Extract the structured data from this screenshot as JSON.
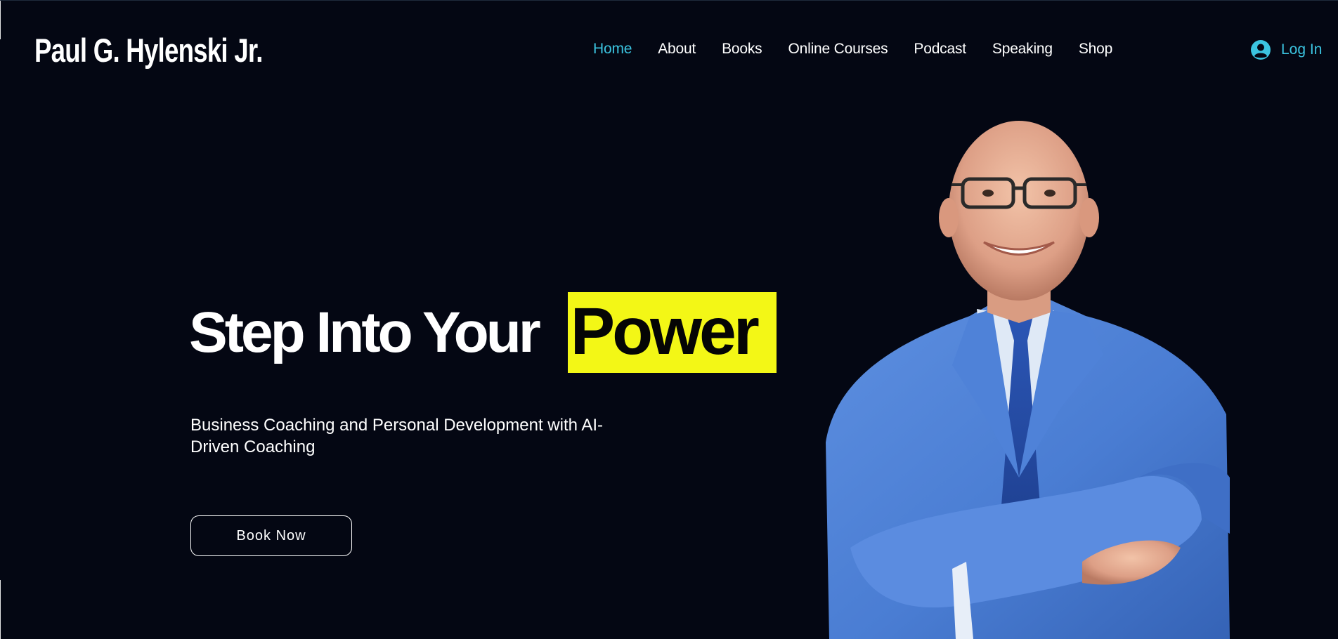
{
  "header": {
    "logo": "Paul G. Hylenski Jr.",
    "nav": [
      {
        "label": "Home",
        "active": true
      },
      {
        "label": "About",
        "active": false
      },
      {
        "label": "Books",
        "active": false
      },
      {
        "label": "Online Courses",
        "active": false
      },
      {
        "label": "Podcast",
        "active": false
      },
      {
        "label": "Speaking",
        "active": false
      },
      {
        "label": "Shop",
        "active": false
      }
    ],
    "login": {
      "label": "Log In",
      "icon": "user-avatar-icon"
    }
  },
  "hero": {
    "title_plain": "Step Into Your",
    "title_highlight": "Power",
    "subtitle": "Business Coaching and Personal Development with AI-Driven Coaching",
    "cta_label": "Book Now",
    "image": "man-in-blue-suit-portrait"
  },
  "colors": {
    "background": "#040713",
    "accent": "#3bc4e0",
    "highlight": "#f3f716",
    "text": "#ffffff"
  }
}
